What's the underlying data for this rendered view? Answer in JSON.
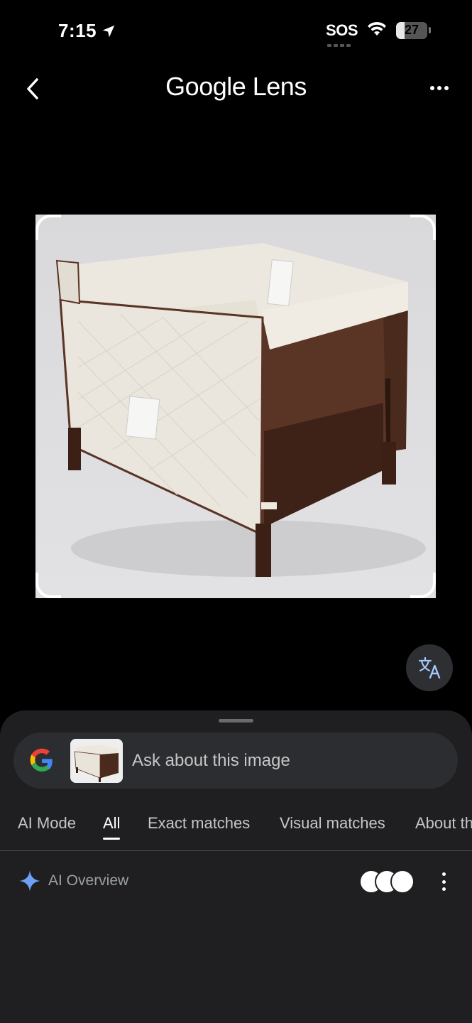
{
  "status_bar": {
    "time": "7:15",
    "sos": "SOS",
    "battery": "27",
    "battery_level": 0.27
  },
  "header": {
    "title": "Google Lens"
  },
  "search": {
    "placeholder": "Ask about this image"
  },
  "tabs": [
    {
      "label": "AI Mode",
      "active": false
    },
    {
      "label": "All",
      "active": true
    },
    {
      "label": "Exact matches",
      "active": false
    },
    {
      "label": "Visual matches",
      "active": false
    },
    {
      "label": "About this image",
      "active": false
    }
  ],
  "ai_overview": {
    "label": "AI Overview"
  },
  "icons": {
    "back": "chevron-left-icon",
    "more": "more-horizontal-icon",
    "translate": "translate-icon",
    "google": "google-g-icon",
    "spark": "gemini-spark-icon",
    "kebab": "more-vertical-icon",
    "location": "location-arrow-icon",
    "wifi": "wifi-icon"
  },
  "colors": {
    "background": "#000000",
    "sheet": "#1f1f21",
    "search_bar": "#2c2d31",
    "spark": "#6ea0f5",
    "muted_text": "#9aa0a6"
  }
}
